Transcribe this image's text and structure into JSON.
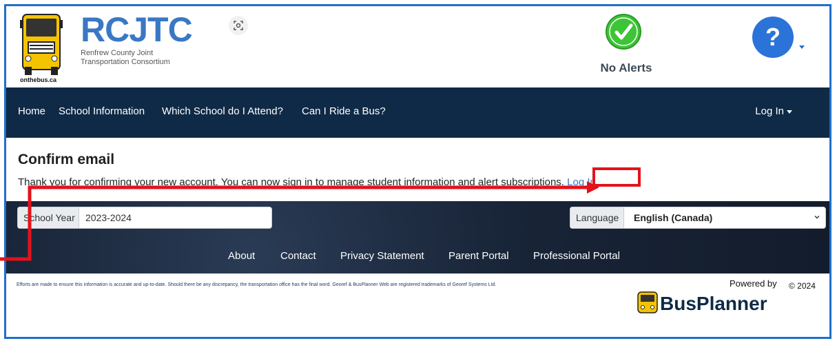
{
  "header": {
    "logo_title": "RCJTC",
    "logo_subtitle_line1": "Renfrew County Joint",
    "logo_subtitle_line2": "Transportation Consortium",
    "logo_site": "onthebus.ca",
    "alert_status": "No Alerts",
    "help_icon": "question-mark"
  },
  "nav": {
    "items": [
      "Home",
      "School Information",
      "Which School do I Attend?",
      "Can I Ride a Bus?"
    ],
    "login_label": "Log In"
  },
  "page": {
    "title": "Confirm email",
    "message": "Thank you for confirming your new account. You can now sign in to manage student information and alert subscriptions.",
    "login_link": "Log In"
  },
  "footer": {
    "school_year_label": "School Year",
    "school_year_value": "2023-2024",
    "language_label": "Language",
    "language_value": "English (Canada)",
    "links": [
      "About",
      "Contact",
      "Privacy Statement",
      "Parent Portal",
      "Professional Portal"
    ],
    "disclaimer": "Efforts are made to ensure this information is accurate and up-to-date. Should there be any discrepancy, the transportation office has the final word. Georef & BusPlanner Web are registered trademarks of Georef Systems Ltd.",
    "powered_by": "Powered by",
    "copyright": "© 2024",
    "brand": "BusPlanner"
  },
  "colors": {
    "nav_bg": "#0f2a46",
    "accent": "#3a78c3",
    "highlight": "#e3121b",
    "alert_ok": "#3ec437"
  }
}
